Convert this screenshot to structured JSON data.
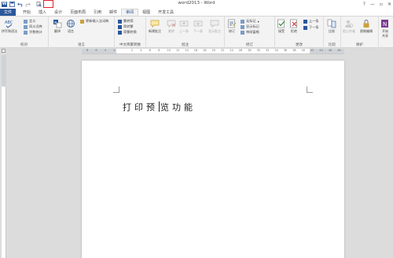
{
  "titlebar": {
    "title": "word2013 - Word",
    "qat_icons": [
      "word-logo-icon",
      "save-icon",
      "undo-icon",
      "redo-icon",
      "print-preview-icon"
    ],
    "word_logo_letter": "W",
    "help": "?",
    "minimize": "—",
    "restore": "▫",
    "close": "✕"
  },
  "tabs": [
    "文件",
    "开始",
    "插入",
    "设计",
    "页面布局",
    "引用",
    "邮件",
    "审阅",
    "视图",
    "开发工具"
  ],
  "active_tab": "审阅",
  "ribbon": {
    "proofing": {
      "label": "校对",
      "spelling": "拼写和语法",
      "define": "定义",
      "thesaurus": "同义词库",
      "word_count": "字数统计"
    },
    "language": {
      "label": "语言",
      "translate": "翻译",
      "language": "语言",
      "update_ime": "更新输入法词典"
    },
    "chinese": {
      "label": "中文简繁转换",
      "to_simplified": "繁转简",
      "to_traditional": "简转繁",
      "convert": "简繁转换"
    },
    "comments": {
      "label": "批注",
      "new": "新建批注",
      "delete": "删除",
      "previous": "上一条",
      "next": "下一条",
      "show": "显示批注"
    },
    "tracking": {
      "label": "修订",
      "track": "修订",
      "markup": "无标记",
      "show_markup": "显示标记",
      "reviewing_pane": "审阅窗格"
    },
    "changes": {
      "label": "更改",
      "accept": "接受",
      "reject": "拒绝",
      "previous": "上一条",
      "next": "下一条"
    },
    "compare": {
      "label": "比较",
      "compare": "比较"
    },
    "protect": {
      "label": "保护",
      "block_authors": "阻止作者",
      "restrict": "限制编辑"
    },
    "onenote": {
      "start": "开始",
      "share": "共享"
    }
  },
  "ruler": {
    "numbers": [
      "8",
      "6",
      "4",
      "2",
      "",
      "2",
      "4",
      "6",
      "8",
      "10",
      "12",
      "14",
      "16",
      "18",
      "20",
      "22",
      "24",
      "26",
      "28",
      "30",
      "32",
      "34",
      "36",
      "38",
      "40",
      "42",
      "44",
      "46",
      "48"
    ]
  },
  "document": {
    "text_before": "打印预",
    "text_after": "览功能"
  }
}
